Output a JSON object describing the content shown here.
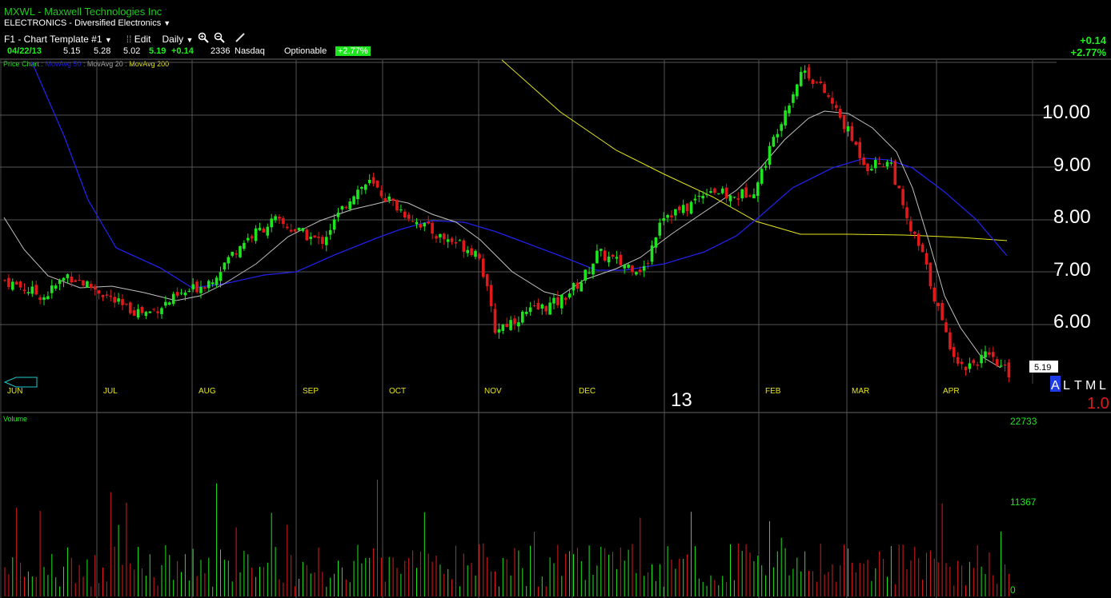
{
  "header": {
    "symbol_line": "MXWL - Maxwell Technologies Inc",
    "industry": "ELECTRONICS - Diversified Electronics",
    "template": "F1 - Chart Template #1",
    "edit_label": "Edit",
    "period": "Daily",
    "date": "04/22/13",
    "open": "5.15",
    "high": "5.28",
    "low": "5.02",
    "close": "5.19",
    "change": "+0.14",
    "volume": "2336",
    "exchange": "Nasdaq",
    "optionable": "Optionable",
    "pct_change": "+2.77%",
    "right_change": "+0.14",
    "right_pct": "+2.77%"
  },
  "legend": {
    "price_chart": "Price Chart",
    "ma50": "MovAvg 50",
    "ma20": "MovAvg 20",
    "ma200": "MovAvg 200"
  },
  "price_axis": {
    "labels": [
      "10.00",
      "9.00",
      "8.00",
      "7.00",
      "6.00"
    ],
    "values": [
      10,
      9,
      8,
      7,
      6
    ],
    "last_price": "5.19"
  },
  "months": [
    "JUN",
    "JUL",
    "AUG",
    "SEP",
    "OCT",
    "NOV",
    "DEC",
    "FEB",
    "MAR",
    "APR"
  ],
  "year_label": "13",
  "corner": {
    "letters": [
      "A",
      "L",
      "T",
      "M",
      "L"
    ],
    "value": "1.0"
  },
  "volume_panel": {
    "title": "Volume",
    "labels": [
      "22733",
      "11367",
      "0"
    ]
  },
  "colors": {
    "up": "#1ee61e",
    "down": "#e01a1a",
    "ma20": "#c8c8c8",
    "ma50": "#1e1ee6",
    "ma200": "#e6e61e",
    "grid": "#555555"
  },
  "chart_data": {
    "type": "candlestick",
    "title": "",
    "ylim": [
      5.0,
      10.95
    ],
    "yticks": [
      6,
      7,
      8,
      9,
      10
    ],
    "x": [
      "JUN",
      "JUL",
      "AUG",
      "SEP",
      "OCT",
      "NOV",
      "DEC",
      "FEB",
      "MAR",
      "APR"
    ],
    "series": [
      {
        "name": "Price Chart",
        "points": [
          [
            0,
            6.9
          ],
          [
            5,
            6.6
          ],
          [
            8,
            7.0
          ],
          [
            12,
            6.7
          ],
          [
            15,
            6.4
          ],
          [
            18,
            6.3
          ],
          [
            22,
            6.6
          ],
          [
            26,
            6.9
          ],
          [
            30,
            7.6
          ],
          [
            34,
            8.0
          ],
          [
            37,
            7.8
          ],
          [
            40,
            7.6
          ],
          [
            44,
            8.5
          ],
          [
            46,
            8.7
          ],
          [
            50,
            8.2
          ],
          [
            52,
            8.0
          ],
          [
            55,
            7.7
          ],
          [
            57,
            7.6
          ],
          [
            60,
            7.4
          ],
          [
            62,
            6.0
          ],
          [
            66,
            6.3
          ],
          [
            70,
            6.5
          ],
          [
            73,
            6.9
          ],
          [
            75,
            7.4
          ],
          [
            78,
            7.2
          ],
          [
            81,
            7.1
          ],
          [
            83,
            8.1
          ],
          [
            86,
            8.2
          ],
          [
            89,
            8.6
          ],
          [
            92,
            8.4
          ],
          [
            95,
            8.6
          ],
          [
            98,
            9.8
          ],
          [
            101,
            10.8
          ],
          [
            104,
            10.3
          ],
          [
            106,
            9.8
          ],
          [
            109,
            9.0
          ],
          [
            112,
            9.1
          ],
          [
            114,
            8.0
          ],
          [
            116,
            7.4
          ],
          [
            119,
            5.9
          ],
          [
            121,
            5.3
          ],
          [
            124,
            5.5
          ],
          [
            127,
            5.2
          ]
        ]
      },
      {
        "name": "MovAvg 20"
      },
      {
        "name": "MovAvg 50"
      },
      {
        "name": "MovAvg 200"
      }
    ]
  }
}
